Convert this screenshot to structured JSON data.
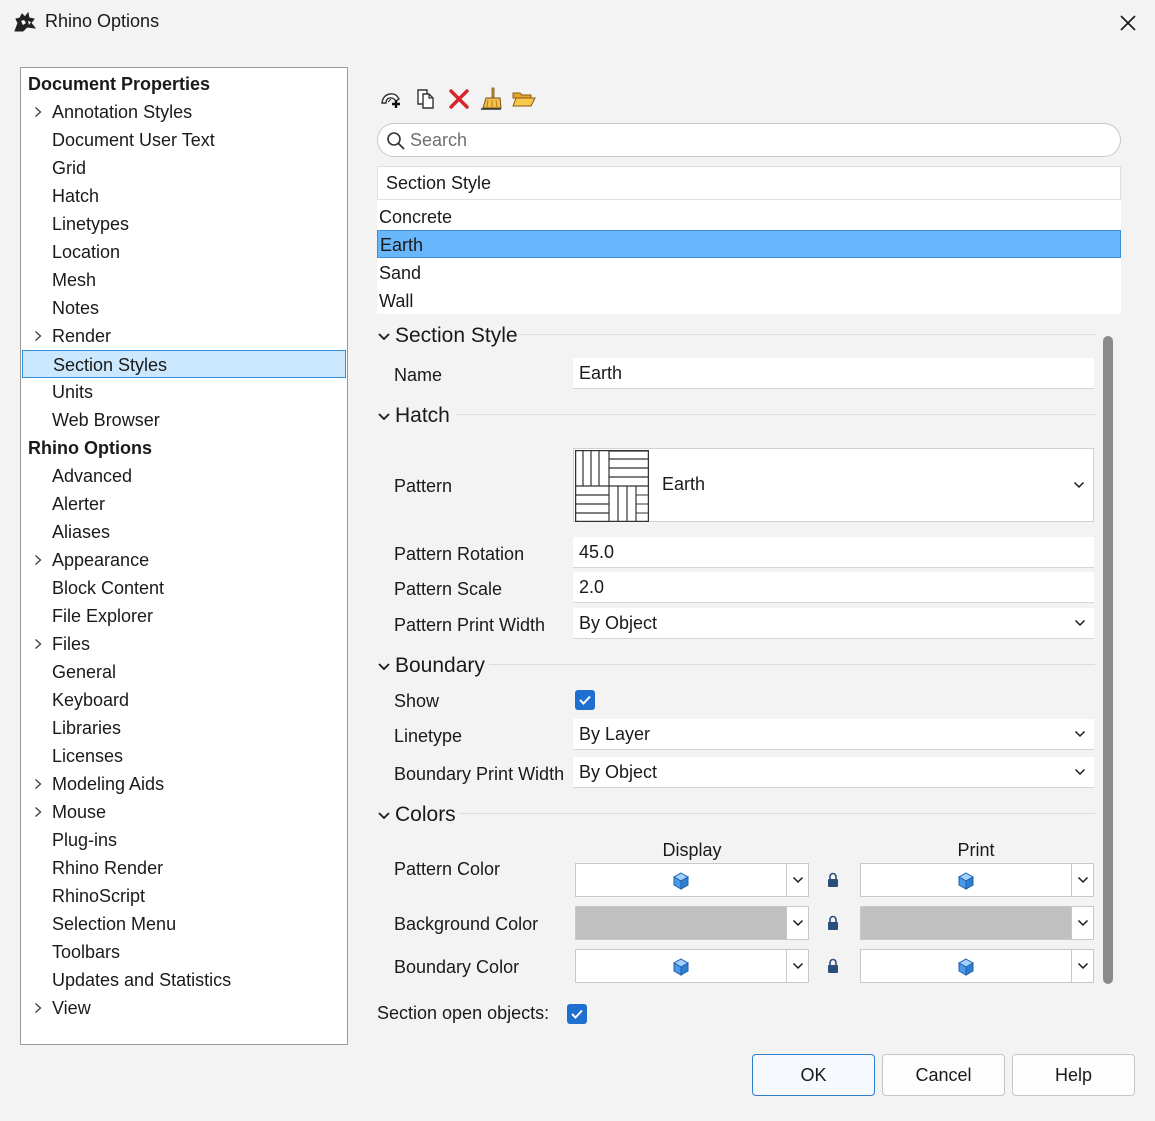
{
  "window": {
    "title": "Rhino Options"
  },
  "tree": {
    "items": [
      {
        "label": "Document Properties",
        "header": true
      },
      {
        "label": "Annotation Styles",
        "expandable": true
      },
      {
        "label": "Document User Text"
      },
      {
        "label": "Grid"
      },
      {
        "label": "Hatch"
      },
      {
        "label": "Linetypes"
      },
      {
        "label": "Location"
      },
      {
        "label": "Mesh"
      },
      {
        "label": "Notes"
      },
      {
        "label": "Render",
        "expandable": true
      },
      {
        "label": "Section Styles",
        "selected": true
      },
      {
        "label": "Units"
      },
      {
        "label": "Web Browser"
      },
      {
        "label": "Rhino Options",
        "header": true
      },
      {
        "label": "Advanced"
      },
      {
        "label": "Alerter"
      },
      {
        "label": "Aliases"
      },
      {
        "label": "Appearance",
        "expandable": true
      },
      {
        "label": "Block Content"
      },
      {
        "label": "File Explorer"
      },
      {
        "label": "Files",
        "expandable": true
      },
      {
        "label": "General"
      },
      {
        "label": "Keyboard"
      },
      {
        "label": "Libraries"
      },
      {
        "label": "Licenses"
      },
      {
        "label": "Modeling Aids",
        "expandable": true
      },
      {
        "label": "Mouse",
        "expandable": true
      },
      {
        "label": "Plug-ins"
      },
      {
        "label": "Rhino Render"
      },
      {
        "label": "RhinoScript"
      },
      {
        "label": "Selection Menu"
      },
      {
        "label": "Toolbars"
      },
      {
        "label": "Updates and Statistics"
      },
      {
        "label": "View",
        "expandable": true
      }
    ]
  },
  "toolbar": {
    "icons": [
      "new-style-icon",
      "copy-icon",
      "delete-icon",
      "brush-icon",
      "open-folder-icon"
    ]
  },
  "search": {
    "placeholder": "Search",
    "value": ""
  },
  "styles_list": {
    "header": "Section Style",
    "items": [
      "Concrete",
      "Earth",
      "Sand",
      "Wall"
    ],
    "selected": "Earth"
  },
  "section_style": {
    "heading": "Section Style",
    "name_label": "Name",
    "name_value": "Earth"
  },
  "hatch": {
    "heading": "Hatch",
    "pattern_label": "Pattern",
    "pattern_value": "Earth",
    "rotation_label": "Pattern Rotation",
    "rotation_value": "45.0",
    "scale_label": "Pattern Scale",
    "scale_value": "2.0",
    "print_width_label": "Pattern Print Width",
    "print_width_value": "By Object"
  },
  "boundary": {
    "heading": "Boundary",
    "show_label": "Show",
    "show_checked": true,
    "linetype_label": "Linetype",
    "linetype_value": "By Layer",
    "print_width_label": "Boundary Print Width",
    "print_width_value": "By Object"
  },
  "colors": {
    "heading": "Colors",
    "display_header": "Display",
    "print_header": "Print",
    "pattern_color_label": "Pattern Color",
    "background_color_label": "Background Color",
    "boundary_color_label": "Boundary Color",
    "accent": "#1f6fd0",
    "by_object_swatch": "#5aa7f0",
    "background_gray": "#c0c0c0"
  },
  "footer": {
    "section_open_label": "Section open objects:",
    "section_open_checked": true,
    "ok_label": "OK",
    "cancel_label": "Cancel",
    "help_label": "Help"
  }
}
